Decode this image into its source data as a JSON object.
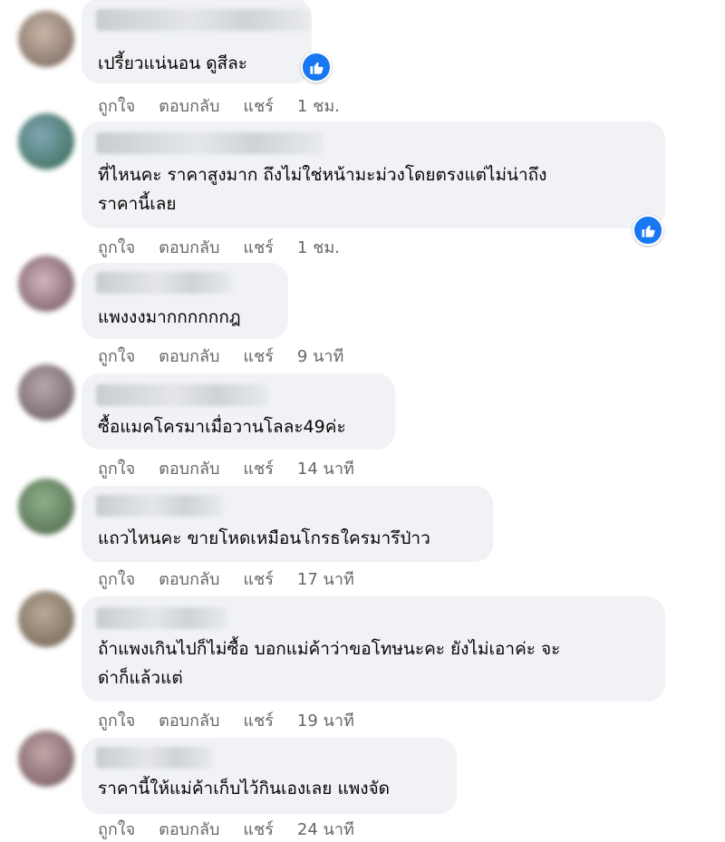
{
  "actions": {
    "like": "ถูกใจ",
    "reply": "ตอบกลับ",
    "share": "แชร์"
  },
  "comments": [
    {
      "lines": [
        "เปรี้ยวแน่นอน ดูสีละ"
      ],
      "time": "1 ชม.",
      "reaction": "like-icon"
    },
    {
      "lines": [
        "ที่ไหนคะ ราคาสูงมาก ถึงไม่ใช่หน้ามะม่วงโดยตรงแต่ไม่น่าถึง",
        "ราคานี้เลย"
      ],
      "time": "1 ชม.",
      "reaction": "like-icon"
    },
    {
      "lines": [
        "แพงงงมากกกกกกฎ"
      ],
      "time": "9 นาที"
    },
    {
      "lines": [
        "ซื้อแมคโครมาเมื่อวานโลละ49ค่ะ"
      ],
      "time": "14 นาที"
    },
    {
      "lines": [
        "แถวไหนคะ ขายโหดเหมือนโกรธใครมารึป่าว"
      ],
      "time": "17 นาที"
    },
    {
      "lines": [
        "ถ้าแพงเกินไปก็ไม่ซื้อ บอกแม่ค้าว่าขอโทษนะคะ ยังไม่เอาค่ะ จะ",
        "ด่าก็แล้วแต่"
      ],
      "time": "19 นาที"
    },
    {
      "lines": [
        "ราคานี้ให้แม่ค้าเก็บไว้กินเองเลย แพงจัด"
      ],
      "time": "24 นาที"
    }
  ],
  "colors": {
    "bubble": "#f0f2f5",
    "meta": "#65676b",
    "like": "#1877f2"
  }
}
